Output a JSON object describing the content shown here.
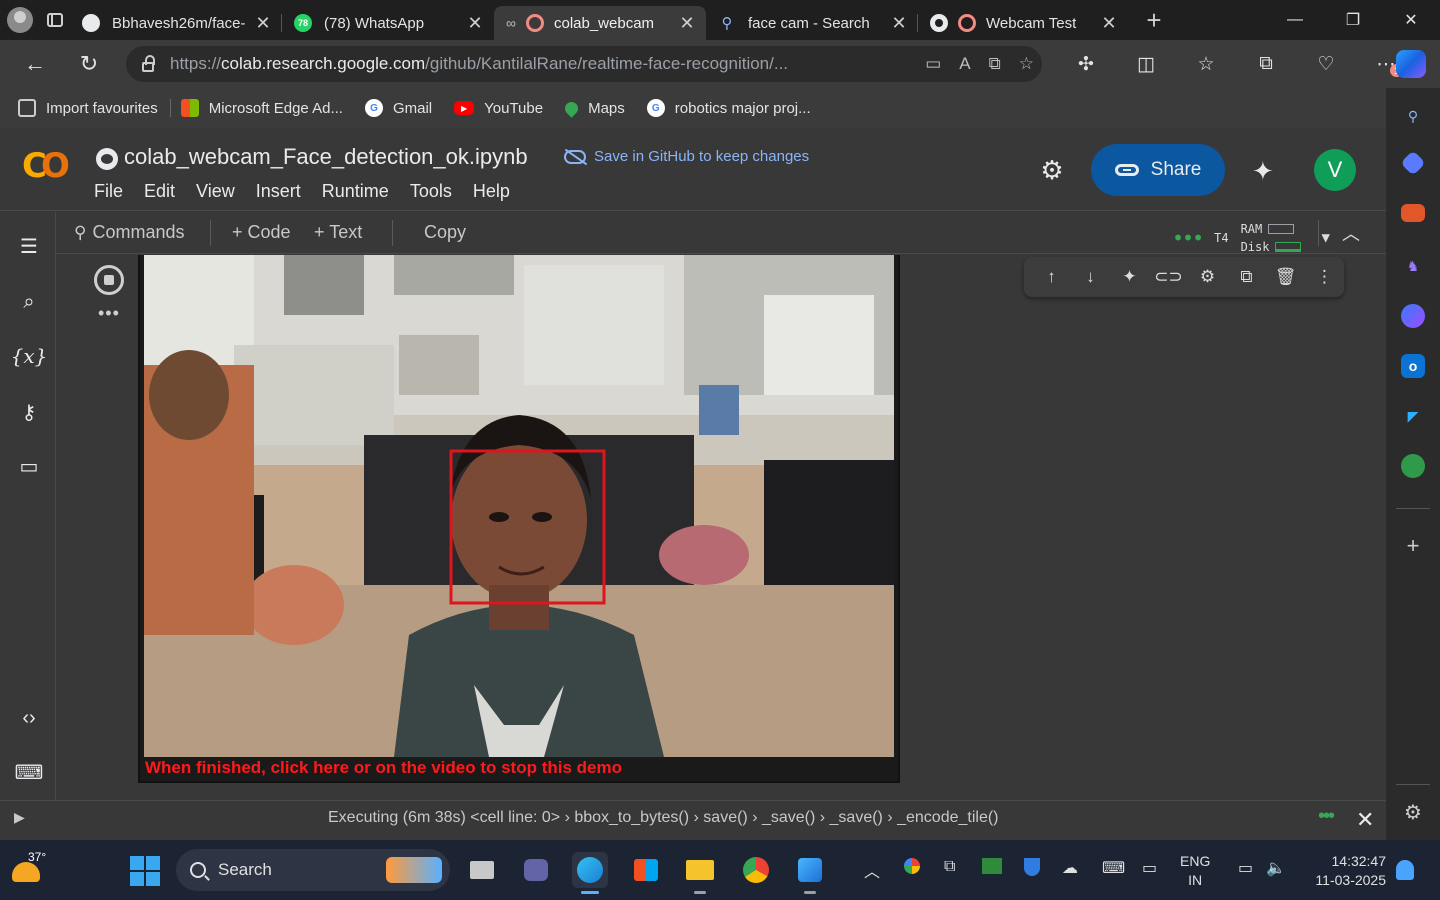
{
  "browser": {
    "tabs": [
      {
        "title": "Bbhavesh26m/face-",
        "favicon": "github-icon"
      },
      {
        "title": "(78) WhatsApp",
        "favicon": "whatsapp-icon",
        "badge": "78"
      },
      {
        "title": "colab_webcam",
        "favicon": "colab-icon",
        "active": true
      },
      {
        "title": "face cam - Search",
        "favicon": "search-icon"
      },
      {
        "title": "Webcam Test",
        "favicon": "webcam-test-icon"
      }
    ],
    "new_tab": "+",
    "window_controls": {
      "minimize": "—",
      "restore": "❐",
      "close": "✕"
    },
    "url_domain": "colab.research.google.com",
    "url_prefix": "https://",
    "url_path": "/github/KantilalRane/realtime-face-recognition/...",
    "favourites": [
      {
        "label": "Import favourites",
        "icon": "import-icon"
      },
      {
        "label": "Microsoft Edge Ad...",
        "icon": "microsoft-icon"
      },
      {
        "label": "Gmail",
        "icon": "google-icon"
      },
      {
        "label": "YouTube",
        "icon": "youtube-icon"
      },
      {
        "label": "Maps",
        "icon": "maps-icon"
      },
      {
        "label": "robotics major proj...",
        "icon": "google-icon"
      }
    ],
    "notif_badge": "1"
  },
  "colab": {
    "notebook_title": "colab_webcam_Face_detection_ok.ipynb",
    "save_github": "Save in GitHub to keep changes",
    "menu": [
      "File",
      "Edit",
      "View",
      "Insert",
      "Runtime",
      "Tools",
      "Help"
    ],
    "share_label": "Share",
    "user_initial": "V",
    "toolbar": {
      "commands": "Commands",
      "code": "+ Code",
      "text": "+ Text",
      "copy": "Copy",
      "runtime_type": "T4",
      "ram_label": "RAM",
      "disk_label": "Disk"
    },
    "output": {
      "stop_text": "When finished, click here or on the video to stop this demo"
    },
    "status": {
      "message": "Executing (6m 38s)  <cell line: 0> › bbox_to_bytes() › save() › _save() › _save() › _encode_tile()"
    }
  },
  "taskbar": {
    "temperature": "37°",
    "search_placeholder": "Search",
    "lang_top": "ENG",
    "lang_bottom": "IN",
    "time": "14:32:47",
    "date": "11-03-2025"
  },
  "colors": {
    "colab_bg": "#383838",
    "share_bg": "#0b57a0",
    "stop_text": "#ff1a1a",
    "face_box": "#e0141c",
    "accent_green": "#34a853"
  }
}
